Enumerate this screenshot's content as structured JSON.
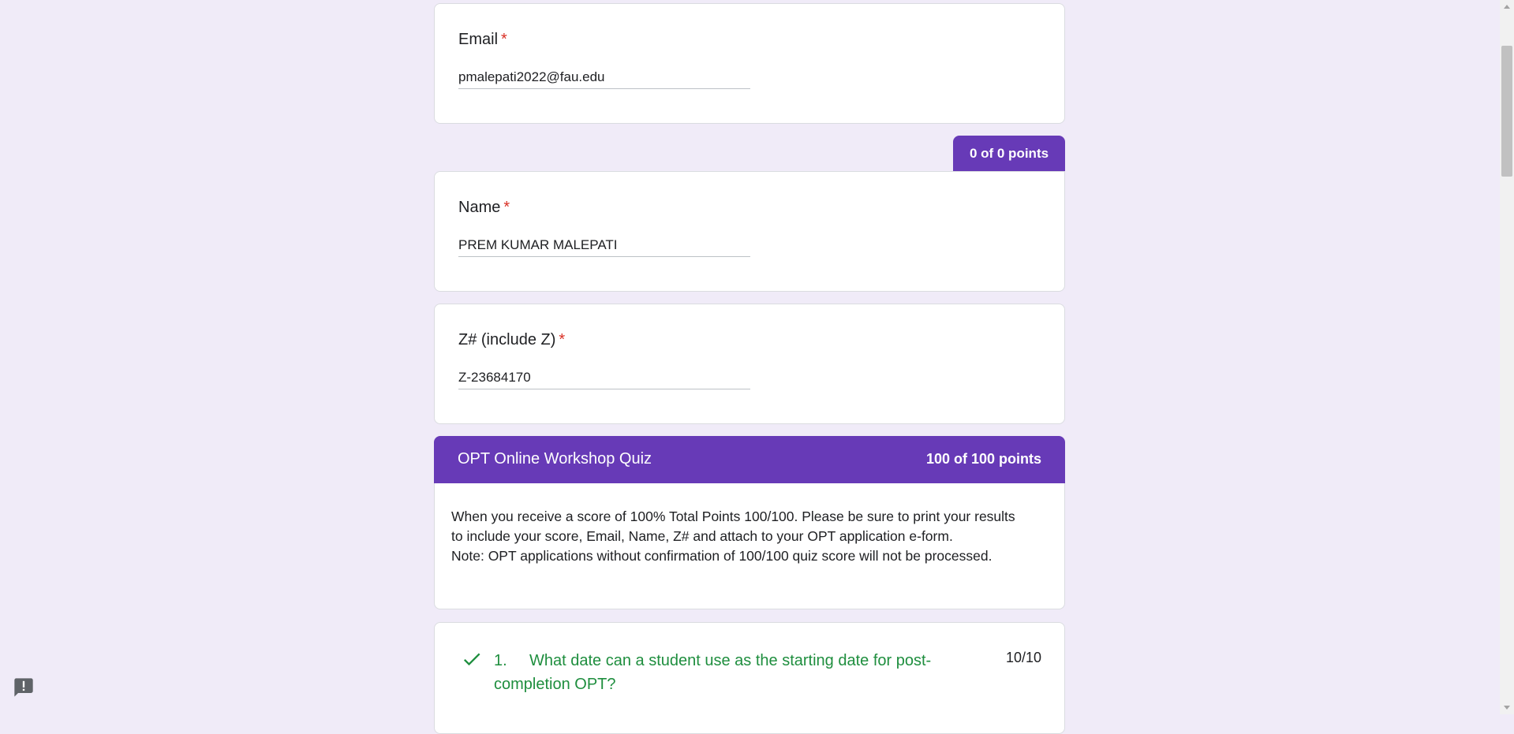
{
  "email_card": {
    "label": "Email",
    "required_mark": "*",
    "value": "pmalepati2022@fau.edu"
  },
  "points_tab": {
    "label": "0 of 0 points"
  },
  "name_card": {
    "label": "Name",
    "required_mark": "*",
    "value": "PREM KUMAR MALEPATI"
  },
  "znumber_card": {
    "label": "Z# (include Z)",
    "required_mark": "*",
    "value": "Z-23684170"
  },
  "quiz_section": {
    "title": "OPT Online Workshop Quiz",
    "points": "100 of 100 points",
    "description_lines": [
      "When you receive a score of 100% Total Points 100/100. Please be sure to print your results",
      "to include your score, Email, Name, Z# and attach to your OPT application e-form.",
      "Note: OPT applications without confirmation of 100/100 quiz score will not be processed."
    ]
  },
  "question_1": {
    "number": "1.",
    "text": "What date can a student use as the starting date for post-completion OPT?",
    "score": "10/10",
    "status_icon": "check-icon",
    "status_color": "#1e8e3e"
  },
  "colors": {
    "background": "#f0ebf8",
    "accent": "#673ab7",
    "required": "#d93025",
    "correct": "#1e8e3e"
  },
  "icons": {
    "feedback": "feedback-icon"
  }
}
